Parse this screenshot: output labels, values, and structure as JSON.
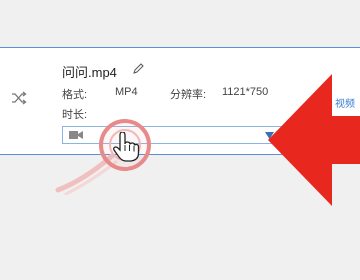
{
  "file": {
    "name": "问问.mp4",
    "format_label": "格式:",
    "format_value": "MP4",
    "resolution_label": "分辨率:",
    "resolution_value": "1121*750",
    "duration_label": "时长:",
    "side_link": "视频"
  },
  "icons": {
    "shuffle": "shuffle-icon",
    "edit": "pencil-icon",
    "camera": "video-camera-icon",
    "dropdown": "chevron-down-icon",
    "cursor": "hand-pointer-icon",
    "annotation_arrow": "red-arrow"
  },
  "colors": {
    "panel_border": "#5b8fd6",
    "link": "#3a7bd5",
    "arrow": "#e8281f",
    "ripple": "#e88a8a"
  }
}
